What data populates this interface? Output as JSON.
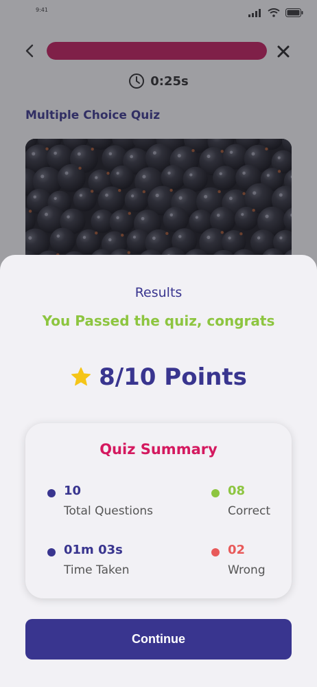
{
  "status_bar": {
    "time": "9:41"
  },
  "header": {
    "progress": 1.0,
    "timer": "0:25s"
  },
  "quiz": {
    "title": "Multiple Choice Quiz"
  },
  "results": {
    "heading": "Results",
    "message": "You Passed the quiz, congrats",
    "points": "8/10 Points"
  },
  "summary": {
    "title": "Quiz Summary",
    "total": {
      "value": "10",
      "label": "Total Questions"
    },
    "correct": {
      "value": "08",
      "label": "Correct"
    },
    "time": {
      "value": "01m 03s",
      "label": "Time Taken"
    },
    "wrong": {
      "value": "02",
      "label": "Wrong"
    }
  },
  "continue_label": "Continue",
  "colors": {
    "primary": "#39358f",
    "accent_pink": "#d4195f",
    "success": "#8dc540",
    "error": "#e85a5a",
    "star": "#f5c518"
  }
}
